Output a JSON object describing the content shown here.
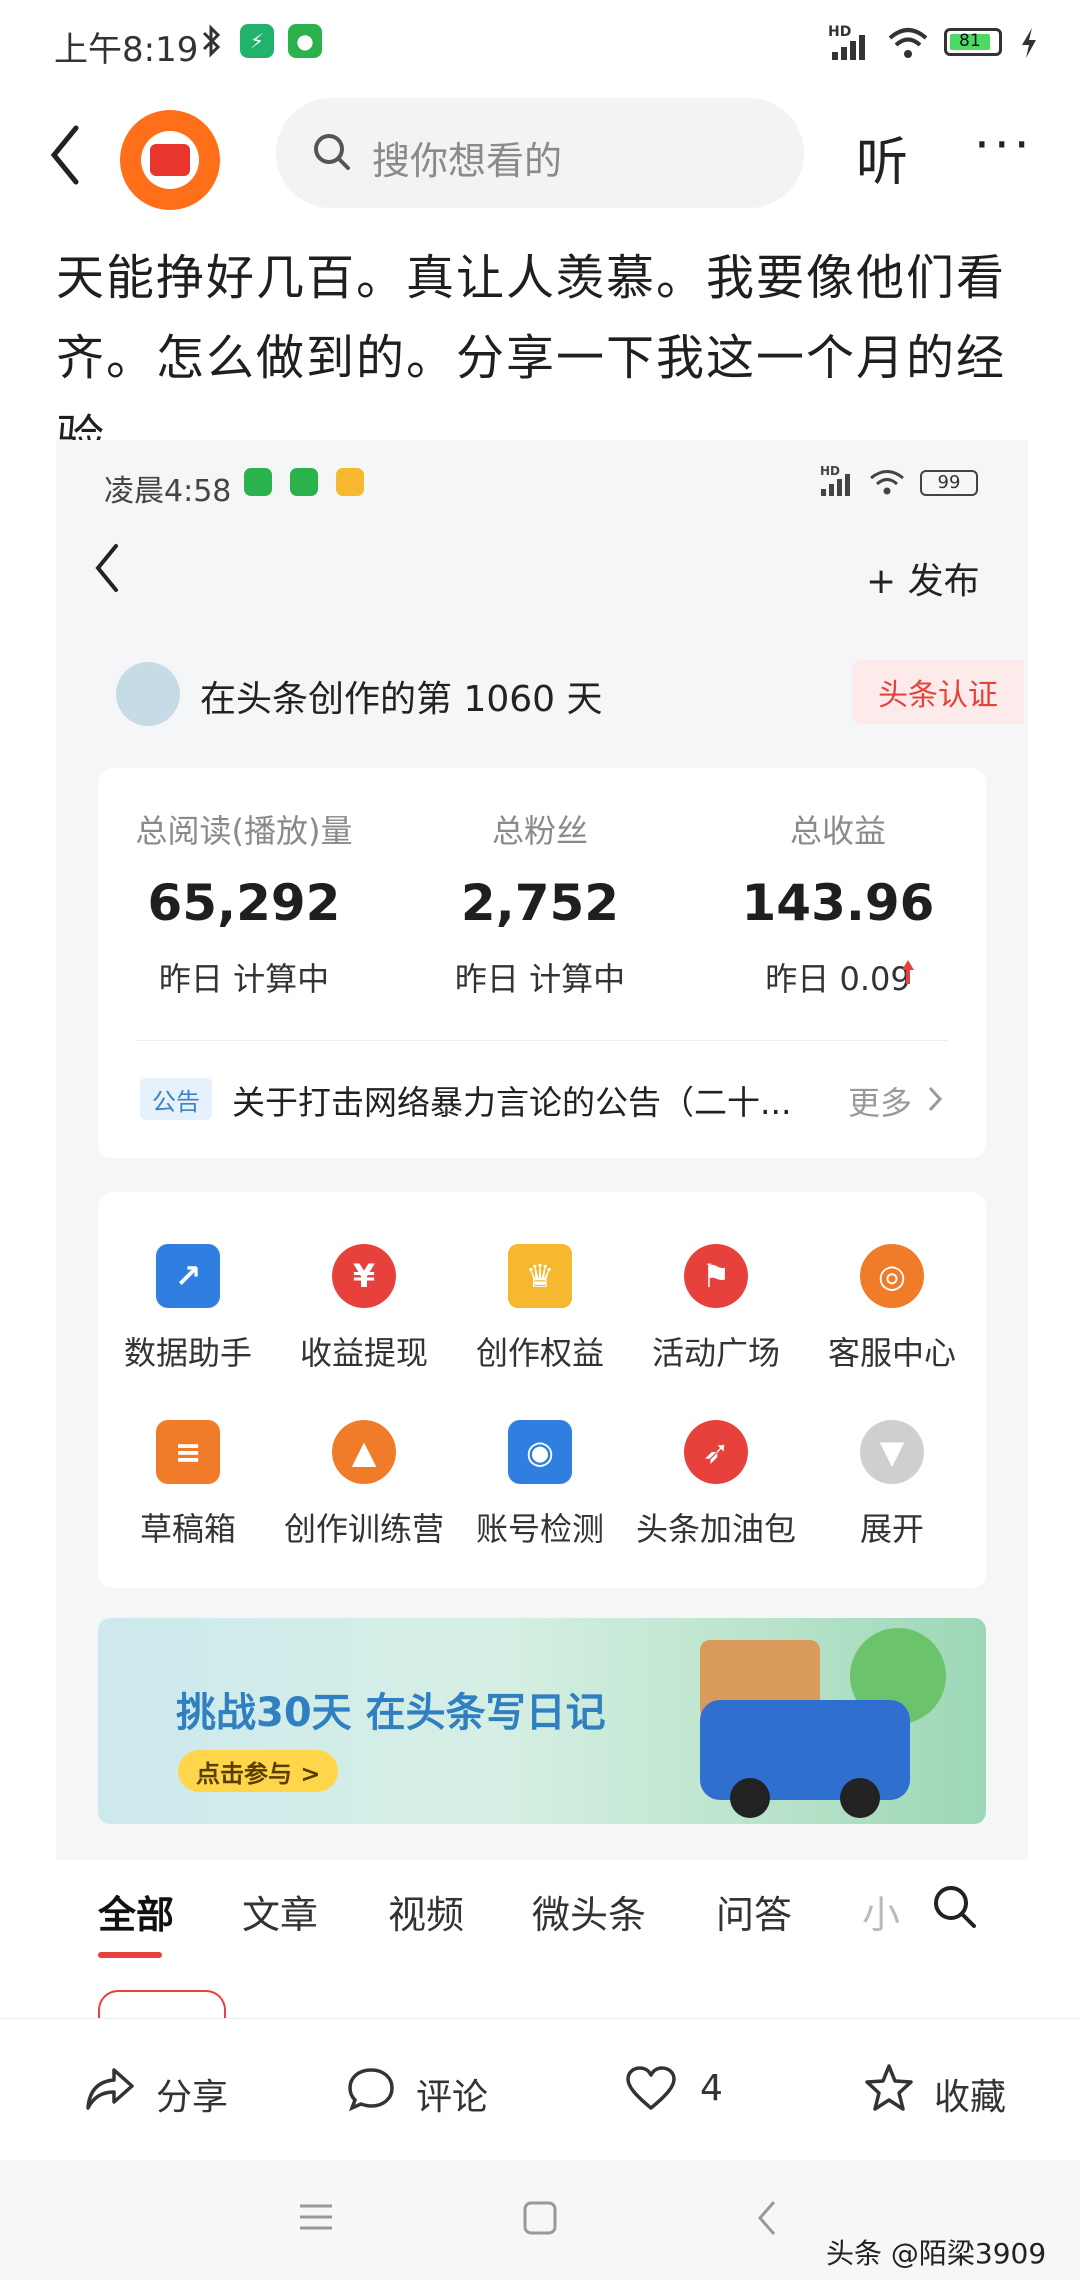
{
  "status_bar": {
    "time": "上午8:19",
    "battery": "81",
    "network": "HD",
    "icons": [
      "bluetooth-icon",
      "app-green-icon",
      "wechat-icon",
      "signal-icon",
      "wifi-icon",
      "battery-icon",
      "charging-icon"
    ]
  },
  "top_nav": {
    "search_placeholder": "搜你想看的",
    "listen_label": "听",
    "more_label": "···"
  },
  "article": {
    "text": "天能挣好几百。真让人羡慕。我要像他们看齐。怎么做到的。分享一下我这一个月的经验"
  },
  "embedded": {
    "status_time": "凌晨4:58",
    "battery": "99",
    "network": "HD",
    "publish_label": "+ 发布",
    "creator_text": "在头条创作的第 1060 天",
    "cert_label": "头条认证",
    "stats": [
      {
        "label": "总阅读(播放)量",
        "value": "65,292",
        "sub": "昨日 计算中"
      },
      {
        "label": "总粉丝",
        "value": "2,752",
        "sub": "昨日 计算中"
      },
      {
        "label": "总收益",
        "value": "143.96",
        "sub": "昨日 0.09"
      }
    ],
    "notice": {
      "tag": "公告",
      "text": "关于打击网络暴力言论的公告（二十...",
      "more": "更多"
    },
    "tools": [
      {
        "label": "数据助手",
        "icon": "chart-icon",
        "color": "#2f7fe0"
      },
      {
        "label": "收益提现",
        "icon": "yen-icon",
        "color": "#e6423b"
      },
      {
        "label": "创作权益",
        "icon": "crown-icon",
        "color": "#f5b82e"
      },
      {
        "label": "活动广场",
        "icon": "flag-icon",
        "color": "#e6423b"
      },
      {
        "label": "客服中心",
        "icon": "headset-icon",
        "color": "#f07c2a"
      },
      {
        "label": "草稿箱",
        "icon": "draft-icon",
        "color": "#f07c2a"
      },
      {
        "label": "创作训练营",
        "icon": "graduation-cap-icon",
        "color": "#f07c2a"
      },
      {
        "label": "账号检测",
        "icon": "shield-search-icon",
        "color": "#2f7fe0"
      },
      {
        "label": "头条加油包",
        "icon": "rocket-icon",
        "color": "#e6423b"
      },
      {
        "label": "展开",
        "icon": "expand-icon",
        "color": "#cfcfcf"
      }
    ],
    "banner": {
      "title": "挑战30天 在头条写日记",
      "button": "点击参与 >"
    },
    "tabs": [
      "全部",
      "文章",
      "视频",
      "微头条",
      "问答",
      "小"
    ]
  },
  "actions": [
    {
      "label": "分享",
      "icon": "share-icon"
    },
    {
      "label": "评论",
      "icon": "comment-icon"
    },
    {
      "label": "4",
      "icon": "heart-icon"
    },
    {
      "label": "收藏",
      "icon": "star-icon"
    }
  ],
  "watermark": "头条 @陌梁3909",
  "colors": {
    "accent": "#e6423b",
    "orange": "#ff6f1a",
    "blue": "#2f7fc1"
  }
}
